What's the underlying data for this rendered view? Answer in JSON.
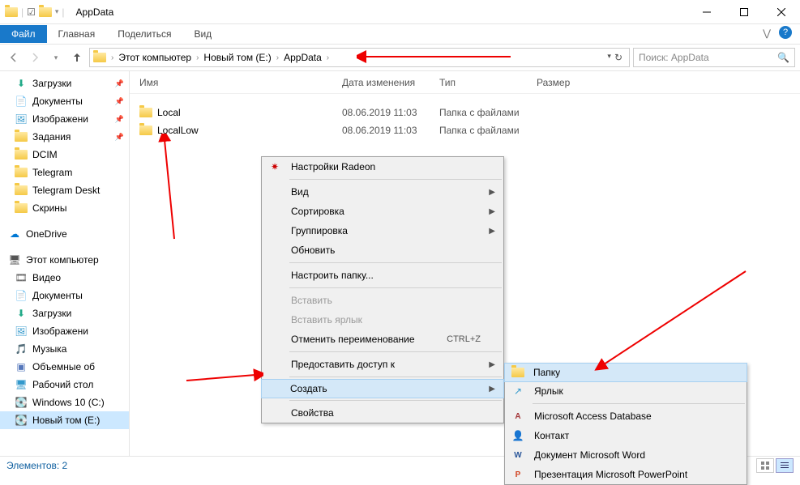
{
  "window": {
    "title": "AppData"
  },
  "ribbon": {
    "file": "Файл",
    "tabs": [
      "Главная",
      "Поделиться",
      "Вид"
    ]
  },
  "breadcrumb": [
    "Этот компьютер",
    "Новый том (E:)",
    "AppData"
  ],
  "search": {
    "placeholder": "Поиск: AppData"
  },
  "columns": {
    "name": "Имя",
    "date": "Дата изменения",
    "type": "Тип",
    "size": "Размер"
  },
  "files": [
    {
      "name": "Local",
      "date": "08.06.2019 11:03",
      "type": "Папка с файлами"
    },
    {
      "name": "LocalLow",
      "date": "08.06.2019 11:03",
      "type": "Папка с файлами"
    }
  ],
  "sidebar": {
    "quick": [
      {
        "label": "Загрузки",
        "kind": "downloads",
        "pinned": true
      },
      {
        "label": "Документы",
        "kind": "documents",
        "pinned": true
      },
      {
        "label": "Изображени",
        "kind": "pictures",
        "pinned": true
      },
      {
        "label": "Задания",
        "kind": "folder",
        "pinned": true
      },
      {
        "label": "DCIM",
        "kind": "folder"
      },
      {
        "label": "Telegram",
        "kind": "folder"
      },
      {
        "label": "Telegram Deskt",
        "kind": "folder"
      },
      {
        "label": "Скрины",
        "kind": "folder"
      }
    ],
    "onedrive": "OneDrive",
    "thispc_label": "Этот компьютер",
    "thispc": [
      {
        "label": "Видео",
        "kind": "video"
      },
      {
        "label": "Документы",
        "kind": "documents"
      },
      {
        "label": "Загрузки",
        "kind": "downloads"
      },
      {
        "label": "Изображени",
        "kind": "pictures"
      },
      {
        "label": "Музыка",
        "kind": "music"
      },
      {
        "label": "Объемные об",
        "kind": "3d"
      },
      {
        "label": "Рабочий стол",
        "kind": "desktop"
      },
      {
        "label": "Windows 10 (C:)",
        "kind": "drive"
      },
      {
        "label": "Новый том (E:)",
        "kind": "drive",
        "selected": true
      }
    ]
  },
  "context_menu": {
    "radeon": "Настройки Radeon",
    "view": "Вид",
    "sort": "Сортировка",
    "group": "Группировка",
    "refresh": "Обновить",
    "customize": "Настроить папку...",
    "paste": "Вставить",
    "paste_shortcut": "Вставить ярлык",
    "undo": "Отменить переименование",
    "undo_key": "CTRL+Z",
    "share": "Предоставить доступ к",
    "create": "Создать",
    "properties": "Свойства"
  },
  "submenu": {
    "folder": "Папку",
    "shortcut": "Ярлык",
    "access": "Microsoft Access Database",
    "contact": "Контакт",
    "word": "Документ Microsoft Word",
    "ppt": "Презентация Microsoft PowerPoint"
  },
  "status": {
    "items": "Элементов: 2"
  }
}
